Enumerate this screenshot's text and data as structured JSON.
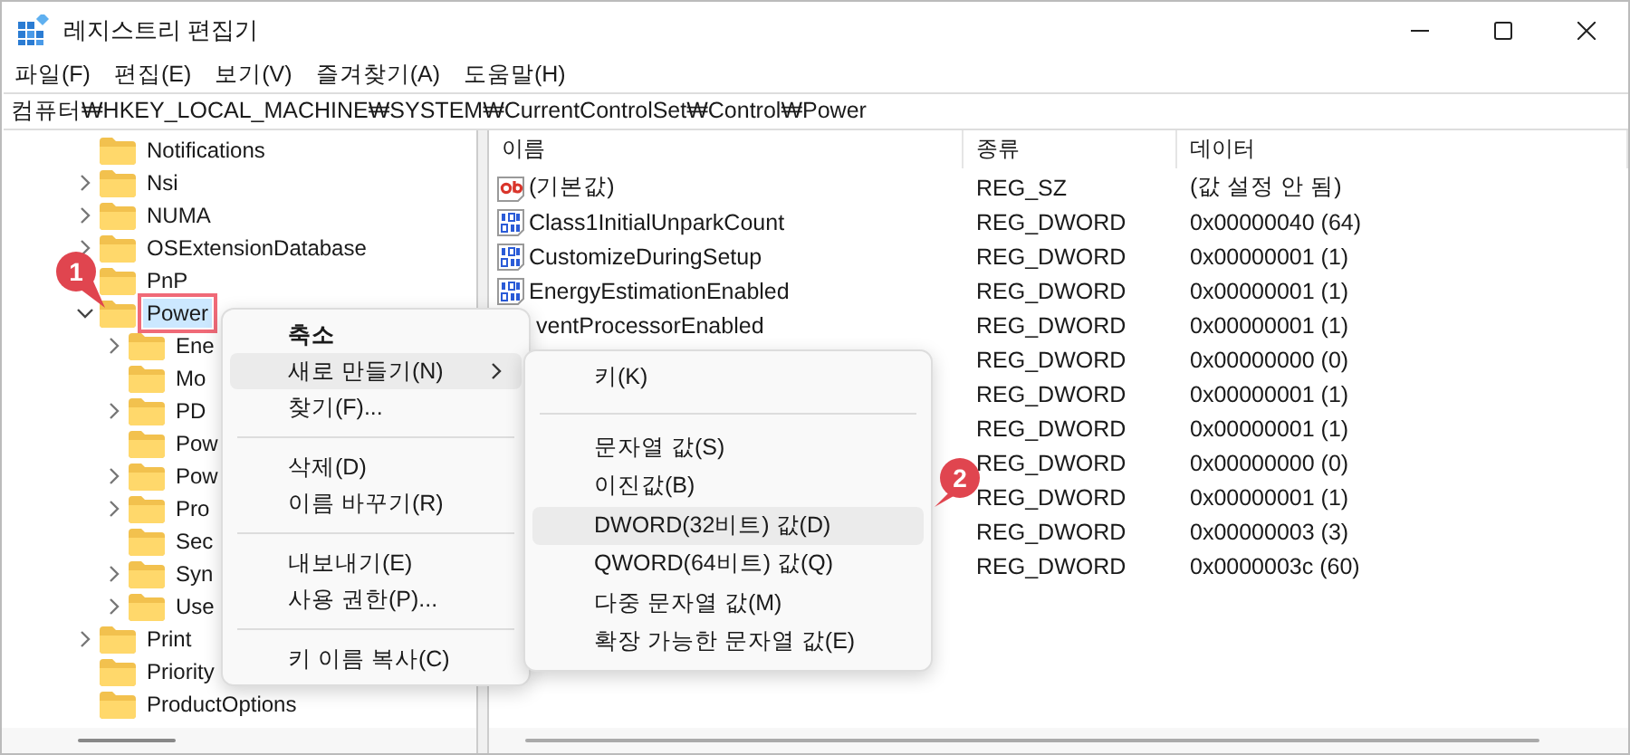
{
  "window": {
    "title": "레지스트리 편집기"
  },
  "menu_bar": [
    "파일(F)",
    "편집(E)",
    "보기(V)",
    "즐겨찾기(A)",
    "도움말(H)"
  ],
  "address": "컴퓨터₩HKEY_LOCAL_MACHINE₩SYSTEM₩CurrentControlSet₩Control₩Power",
  "tree": [
    {
      "label": "Notifications",
      "kind": "leaf",
      "selected": false
    },
    {
      "label": "Nsi",
      "kind": "branch",
      "expanded": false,
      "selected": false
    },
    {
      "label": "NUMA",
      "kind": "branch",
      "expanded": false,
      "selected": false
    },
    {
      "label": "OSExtensionDatabase",
      "kind": "branch",
      "expanded": false,
      "selected": false
    },
    {
      "label": "PnP",
      "kind": "leaf",
      "selected": false
    },
    {
      "label": "Power",
      "kind": "branch",
      "expanded": true,
      "selected": true,
      "annotated": true,
      "children": [
        {
          "label": "Ene",
          "kind": "branch",
          "expanded": false,
          "selected": false
        },
        {
          "label": "Mo",
          "kind": "leaf",
          "selected": false
        },
        {
          "label": "PD",
          "kind": "branch",
          "expanded": false,
          "selected": false
        },
        {
          "label": "Pow",
          "kind": "leaf",
          "selected": false
        },
        {
          "label": "Pow",
          "kind": "branch",
          "expanded": false,
          "selected": false
        },
        {
          "label": "Pro",
          "kind": "branch",
          "expanded": false,
          "selected": false
        },
        {
          "label": "Sec",
          "kind": "leaf",
          "selected": false
        },
        {
          "label": "Syn",
          "kind": "branch",
          "expanded": false,
          "selected": false
        },
        {
          "label": "Use",
          "kind": "branch",
          "expanded": false,
          "selected": false
        }
      ]
    },
    {
      "label": "Print",
      "kind": "branch",
      "expanded": false,
      "selected": false
    },
    {
      "label": "Priority",
      "kind": "leaf",
      "selected": false
    },
    {
      "label": "ProductOptions",
      "kind": "leaf",
      "selected": false
    }
  ],
  "table": {
    "columns": [
      "이름",
      "종류",
      "데이터"
    ],
    "rows": [
      {
        "kind": "string",
        "name": "(기본값)",
        "type": "REG_SZ",
        "data": "(값 설정 안 됨)"
      },
      {
        "kind": "dword",
        "name": "Class1InitialUnparkCount",
        "type": "REG_DWORD",
        "data": "0x00000040 (64)"
      },
      {
        "kind": "dword",
        "name": "CustomizeDuringSetup",
        "type": "REG_DWORD",
        "data": "0x00000001 (1)"
      },
      {
        "kind": "dword",
        "name": "EnergyEstimationEnabled",
        "type": "REG_DWORD",
        "data": "0x00000001 (1)"
      },
      {
        "name": "ventProcessorEnabled",
        "type": "REG_DWORD",
        "data": "0x00000001 (1)"
      },
      {
        "type": "REG_DWORD",
        "data": "0x00000000 (0)"
      },
      {
        "type": "REG_DWORD",
        "data": "0x00000001 (1)"
      },
      {
        "type": "REG_DWORD",
        "data": "0x00000001 (1)"
      },
      {
        "type": "REG_DWORD",
        "data": "0x00000000 (0)"
      },
      {
        "type": "REG_DWORD",
        "data": "0x00000001 (1)"
      },
      {
        "type": "REG_DWORD",
        "data": "0x00000003 (3)"
      },
      {
        "type": "REG_DWORD",
        "data": "0x0000003c (60)"
      }
    ]
  },
  "context_menu": [
    {
      "kind": "item",
      "label": "축소",
      "default": true,
      "submenu": false,
      "selected": false
    },
    {
      "kind": "item",
      "label": "새로 만들기(N)",
      "default": false,
      "submenu": true,
      "selected": true
    },
    {
      "kind": "item",
      "label": "찾기(F)...",
      "default": false,
      "submenu": false,
      "selected": false
    },
    {
      "kind": "separator"
    },
    {
      "kind": "item",
      "label": "삭제(D)",
      "default": false,
      "submenu": false,
      "selected": false
    },
    {
      "kind": "item",
      "label": "이름 바꾸기(R)",
      "default": false,
      "submenu": false,
      "selected": false
    },
    {
      "kind": "separator"
    },
    {
      "kind": "item",
      "label": "내보내기(E)",
      "default": false,
      "submenu": false,
      "selected": false
    },
    {
      "kind": "item",
      "label": "사용 권한(P)...",
      "default": false,
      "submenu": false,
      "selected": false
    },
    {
      "kind": "separator"
    },
    {
      "kind": "item",
      "label": "키 이름 복사(C)",
      "default": false,
      "submenu": false,
      "selected": false
    }
  ],
  "submenu": [
    {
      "kind": "item",
      "label": "키(K)",
      "selected": false
    },
    {
      "kind": "separator"
    },
    {
      "kind": "item",
      "label": "문자열 값(S)",
      "selected": false
    },
    {
      "kind": "item",
      "label": "이진값(B)",
      "selected": false
    },
    {
      "kind": "item",
      "label": "DWORD(32비트) 값(D)",
      "selected": true
    },
    {
      "kind": "item",
      "label": "QWORD(64비트) 값(Q)",
      "selected": false
    },
    {
      "kind": "item",
      "label": "다중 문자열 값(M)",
      "selected": false
    },
    {
      "kind": "item",
      "label": "확장 가능한 문자열 값(E)",
      "selected": false
    }
  ],
  "callouts": [
    "1",
    "2"
  ]
}
